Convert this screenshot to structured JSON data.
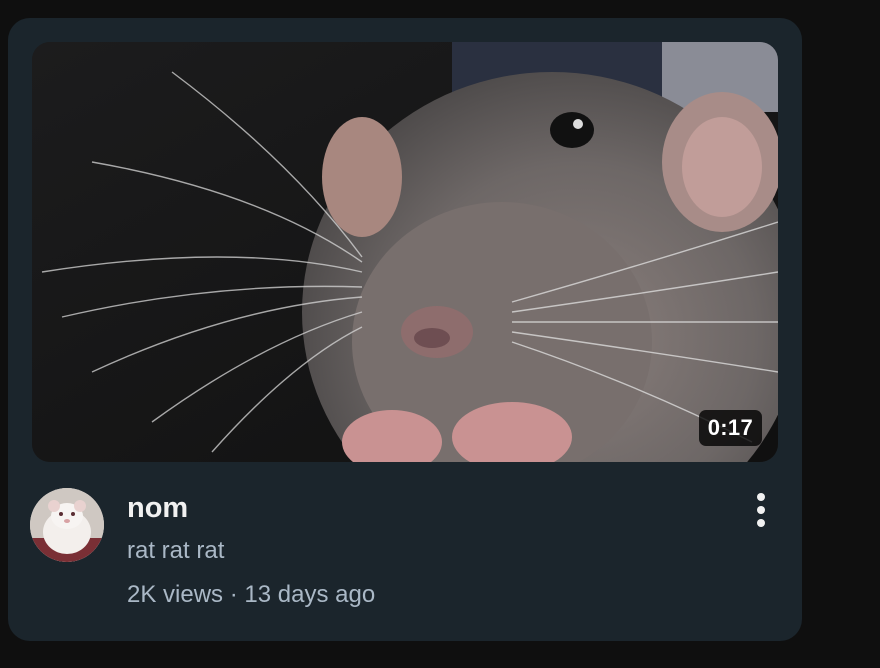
{
  "video": {
    "duration": "0:17",
    "title": "nom",
    "channel": "rat rat rat",
    "views": "2K views",
    "separator": "·",
    "age": "13 days ago"
  },
  "icons": {
    "menu": "more-vertical-icon"
  },
  "colors": {
    "page_bg": "#0f0f0f",
    "card_bg": "#1b252c",
    "title_text": "#f1f1f1",
    "meta_text": "#aab8c6"
  }
}
